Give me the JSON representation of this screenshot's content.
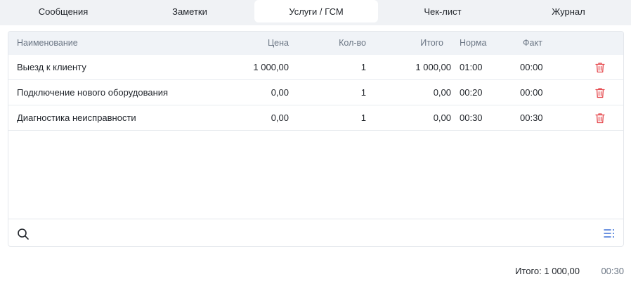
{
  "tabs": [
    {
      "label": "Сообщения"
    },
    {
      "label": "Заметки"
    },
    {
      "label": "Услуги / ГСМ"
    },
    {
      "label": "Чек-лист"
    },
    {
      "label": "Журнал"
    }
  ],
  "active_tab": "Услуги / ГСМ",
  "table": {
    "columns": [
      "Наименование",
      "Цена",
      "Кол-во",
      "Итого",
      "Норма",
      "Факт"
    ],
    "rows": [
      {
        "name": "Выезд к клиенту",
        "price": "1 000,00",
        "qty": "1",
        "total": "1 000,00",
        "norm": "01:00",
        "fact": "00:00"
      },
      {
        "name": "Подключение нового оборудования",
        "price": "0,00",
        "qty": "1",
        "total": "0,00",
        "norm": "00:20",
        "fact": "00:00"
      },
      {
        "name": "Диагностика неисправности",
        "price": "0,00",
        "qty": "1",
        "total": "0,00",
        "norm": "00:30",
        "fact": "00:30"
      }
    ]
  },
  "footer": {
    "total_label": "Итого: 1 000,00",
    "total_time": "00:30"
  },
  "icons": {
    "delete": "trash-icon",
    "search": "search-icon",
    "list": "list-settings-icon"
  },
  "colors": {
    "delete": "#e5484d",
    "accent": "#3b6fd6"
  }
}
